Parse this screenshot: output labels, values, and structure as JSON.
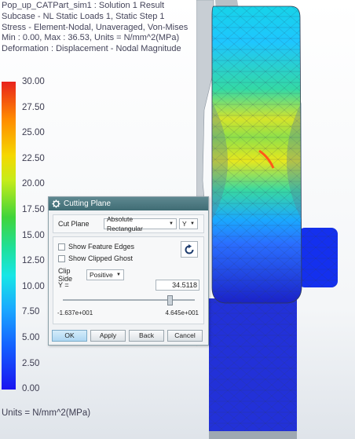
{
  "header": {
    "lines": [
      "Pop_up_CATPart_sim1 : Solution 1 Result",
      "Subcase - NL Static Loads 1, Static Step 1",
      "Stress - Element-Nodal, Unaveraged, Von-Mises",
      "Min : 0.00, Max : 36.53, Units = N/mm^2(MPa)",
      "Deformation : Displacement - Nodal Magnitude"
    ]
  },
  "legend": {
    "values": [
      "30.00",
      "27.50",
      "25.00",
      "22.50",
      "20.00",
      "17.50",
      "15.00",
      "12.50",
      "10.00",
      "7.50",
      "5.00",
      "2.50",
      "0.00"
    ],
    "units": "Units = N/mm^2(MPa)"
  },
  "dialog": {
    "title": "Cutting Plane",
    "cut_plane_label": "Cut Plane",
    "cut_plane_value": "Absolute Rectangular",
    "axis_value": "Y",
    "show_feature_edges": {
      "label": "Show Feature Edges",
      "checked": false
    },
    "show_clipped_ghost": {
      "label": "Show Clipped Ghost",
      "checked": false
    },
    "clip_side_label": "Clip Side",
    "clip_side_value": "Positive",
    "y_label": "Y =",
    "y_value": "34.5118",
    "slider_fraction": 0.81,
    "min_label": "-1.637e+001",
    "max_label": "4.645e+001",
    "buttons": {
      "ok": "OK",
      "apply": "Apply",
      "back": "Back",
      "cancel": "Cancel"
    }
  },
  "colors": {
    "title_bar": "#4a7880",
    "accent_button": "#b8dcf4"
  }
}
